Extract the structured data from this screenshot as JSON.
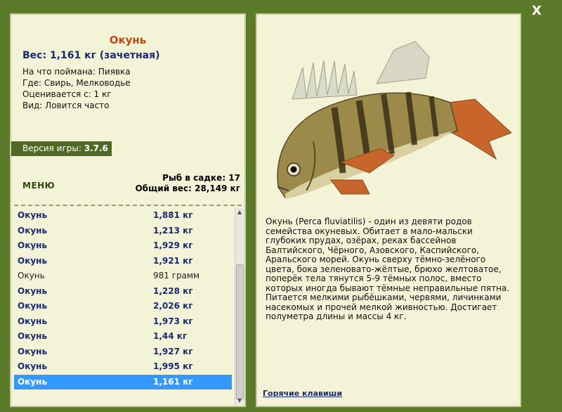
{
  "window": {
    "close_label": "X"
  },
  "fish": {
    "title": "Окунь",
    "weight": "Вес: 1,161 кг (зачетная)",
    "caught_with": "На что поймана: Пиявка",
    "where": "Где: Свирь, Мелководье",
    "rated_from": "Оценивается с: 1 кг",
    "kind": "Вид: Ловится часто"
  },
  "version": {
    "label": "Версия игры:",
    "value": "3.7.6"
  },
  "menu_label": "МЕНЮ",
  "stats": {
    "fish_in_cage": "Рыб в садке: 17",
    "total_weight": "Общий вес: 28,149 кг"
  },
  "catch_list": [
    {
      "name": "Окунь",
      "weight": "1,881 кг",
      "style": "cnt"
    },
    {
      "name": "Окунь",
      "weight": "1,213 кг",
      "style": "cnt"
    },
    {
      "name": "Окунь",
      "weight": "1,929 кг",
      "style": "cnt"
    },
    {
      "name": "Окунь",
      "weight": "1,921 кг",
      "style": "cnt"
    },
    {
      "name": "Окунь",
      "weight": "981 грамм",
      "style": "normal"
    },
    {
      "name": "Окунь",
      "weight": "1,228 кг",
      "style": "cnt"
    },
    {
      "name": "Окунь",
      "weight": "2,026 кг",
      "style": "cnt"
    },
    {
      "name": "Окунь",
      "weight": "1,973 кг",
      "style": "cnt"
    },
    {
      "name": "Окунь",
      "weight": "1,44 кг",
      "style": "cnt"
    },
    {
      "name": "Окунь",
      "weight": "1,927 кг",
      "style": "cnt"
    },
    {
      "name": "Окунь",
      "weight": "1,995 кг",
      "style": "cnt"
    },
    {
      "name": "Окунь",
      "weight": "1,161 кг",
      "style": "sel"
    }
  ],
  "description": "Окунь (Perca fluviatilis) - один из девяти родов семейства окуневых. Обитает в мало-мальски глубоких прудах, озёрах, реках бассейнов Балтийского, Чёрного, Азовского, Каспийского, Аральского морей. Окунь сверху тёмно-зелёного цвета, бока зеленовато-жёлтые, брюхо желтоватое, поперёк тела тянутся 5-9 тёмных полос, вместо которых иногда бывают тёмные неправильные пятна. Питается мелкими рыбёшками, червями, личинками насекомых и прочей мелкой живностью. Достигает полуметра длины и массы 4 кг.",
  "hotkeys_label": "Горячие клавиши",
  "colors": {
    "background": "#5b7a2a",
    "panel": "#f3f3d8",
    "title": "#b84a12",
    "counted": "#1a2a6e",
    "selected": "#3399ff"
  }
}
